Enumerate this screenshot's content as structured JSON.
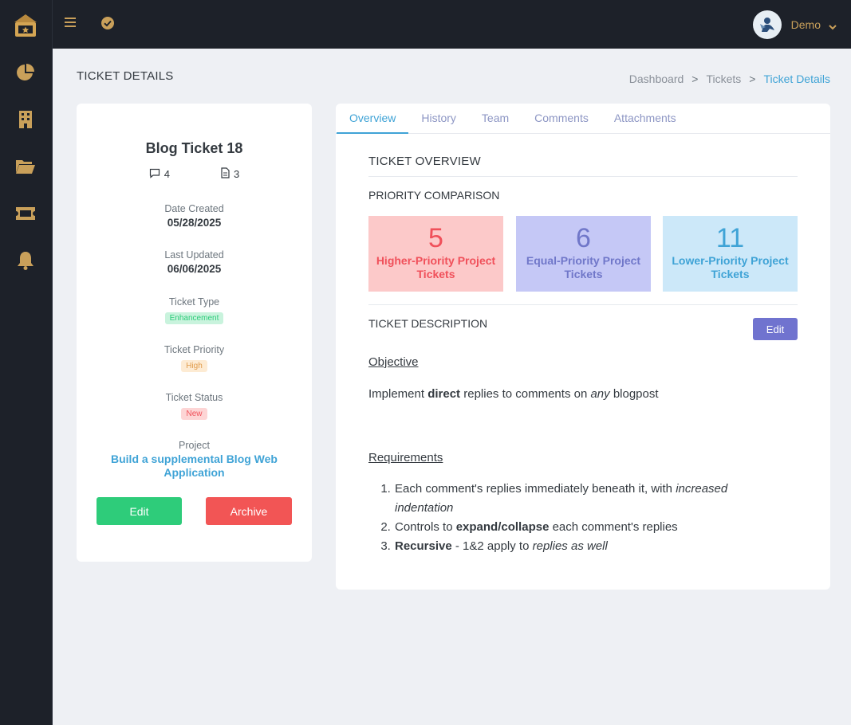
{
  "topbar": {
    "user_name": "Demo"
  },
  "page": {
    "title": "TICKET DETAILS"
  },
  "breadcrumb": {
    "items": [
      "Dashboard",
      "Tickets",
      "Ticket Details"
    ],
    "separator": ">"
  },
  "ticket": {
    "name": "Blog Ticket 18",
    "comment_count": "4",
    "attachment_count": "3",
    "date_created_label": "Date Created",
    "date_created": "05/28/2025",
    "last_updated_label": "Last Updated",
    "last_updated": "06/06/2025",
    "type_label": "Ticket Type",
    "type": "Enhancement",
    "priority_label": "Ticket Priority",
    "priority": "High",
    "status_label": "Ticket Status",
    "status": "New",
    "project_label": "Project",
    "project": "Build a supplemental Blog Web Application",
    "edit_label": "Edit",
    "archive_label": "Archive"
  },
  "tabs": [
    "Overview",
    "History",
    "Team",
    "Comments",
    "Attachments"
  ],
  "overview": {
    "title": "TICKET OVERVIEW",
    "priority_title": "PRIORITY COMPARISON",
    "higher": {
      "value": "5",
      "label": "Higher-Priority Project Tickets"
    },
    "equal": {
      "value": "6",
      "label": "Equal-Priority Project Tickets"
    },
    "lower": {
      "value": "11",
      "label": "Lower-Priority Project Tickets"
    },
    "description_title": "TICKET DESCRIPTION",
    "description_edit": "Edit"
  },
  "description": {
    "objective_heading": "Objective",
    "objective_parts": [
      "Implement ",
      "direct",
      " replies to comments on ",
      "any",
      " blogpost"
    ],
    "requirements_heading": "Requirements",
    "req1_parts": [
      "Each comment's replies immediately beneath it, with ",
      "increased indentation"
    ],
    "req2_parts": [
      "Controls to ",
      "expand/collapse",
      " each comment's replies"
    ],
    "req3_parts": [
      "Recursive",
      " - 1&2 apply to ",
      "replies as well"
    ]
  },
  "colors": {
    "sidebar_bg": "#1d2129",
    "accent_gold": "#c9a05a",
    "link_blue": "#3fa3d6",
    "edit_green": "#2ecc7a",
    "archive_red": "#f25555",
    "desc_edit_purple": "#7073cf"
  },
  "icons": {
    "sidebar": [
      "ticket-logo-icon",
      "pie-chart-icon",
      "building-icon",
      "folder-open-icon",
      "ticket-icon",
      "bell-icon"
    ],
    "topbar": [
      "hamburger-icon",
      "check-circle-icon",
      "chevron-down-icon"
    ],
    "counts": [
      "comment-icon",
      "file-icon"
    ]
  }
}
